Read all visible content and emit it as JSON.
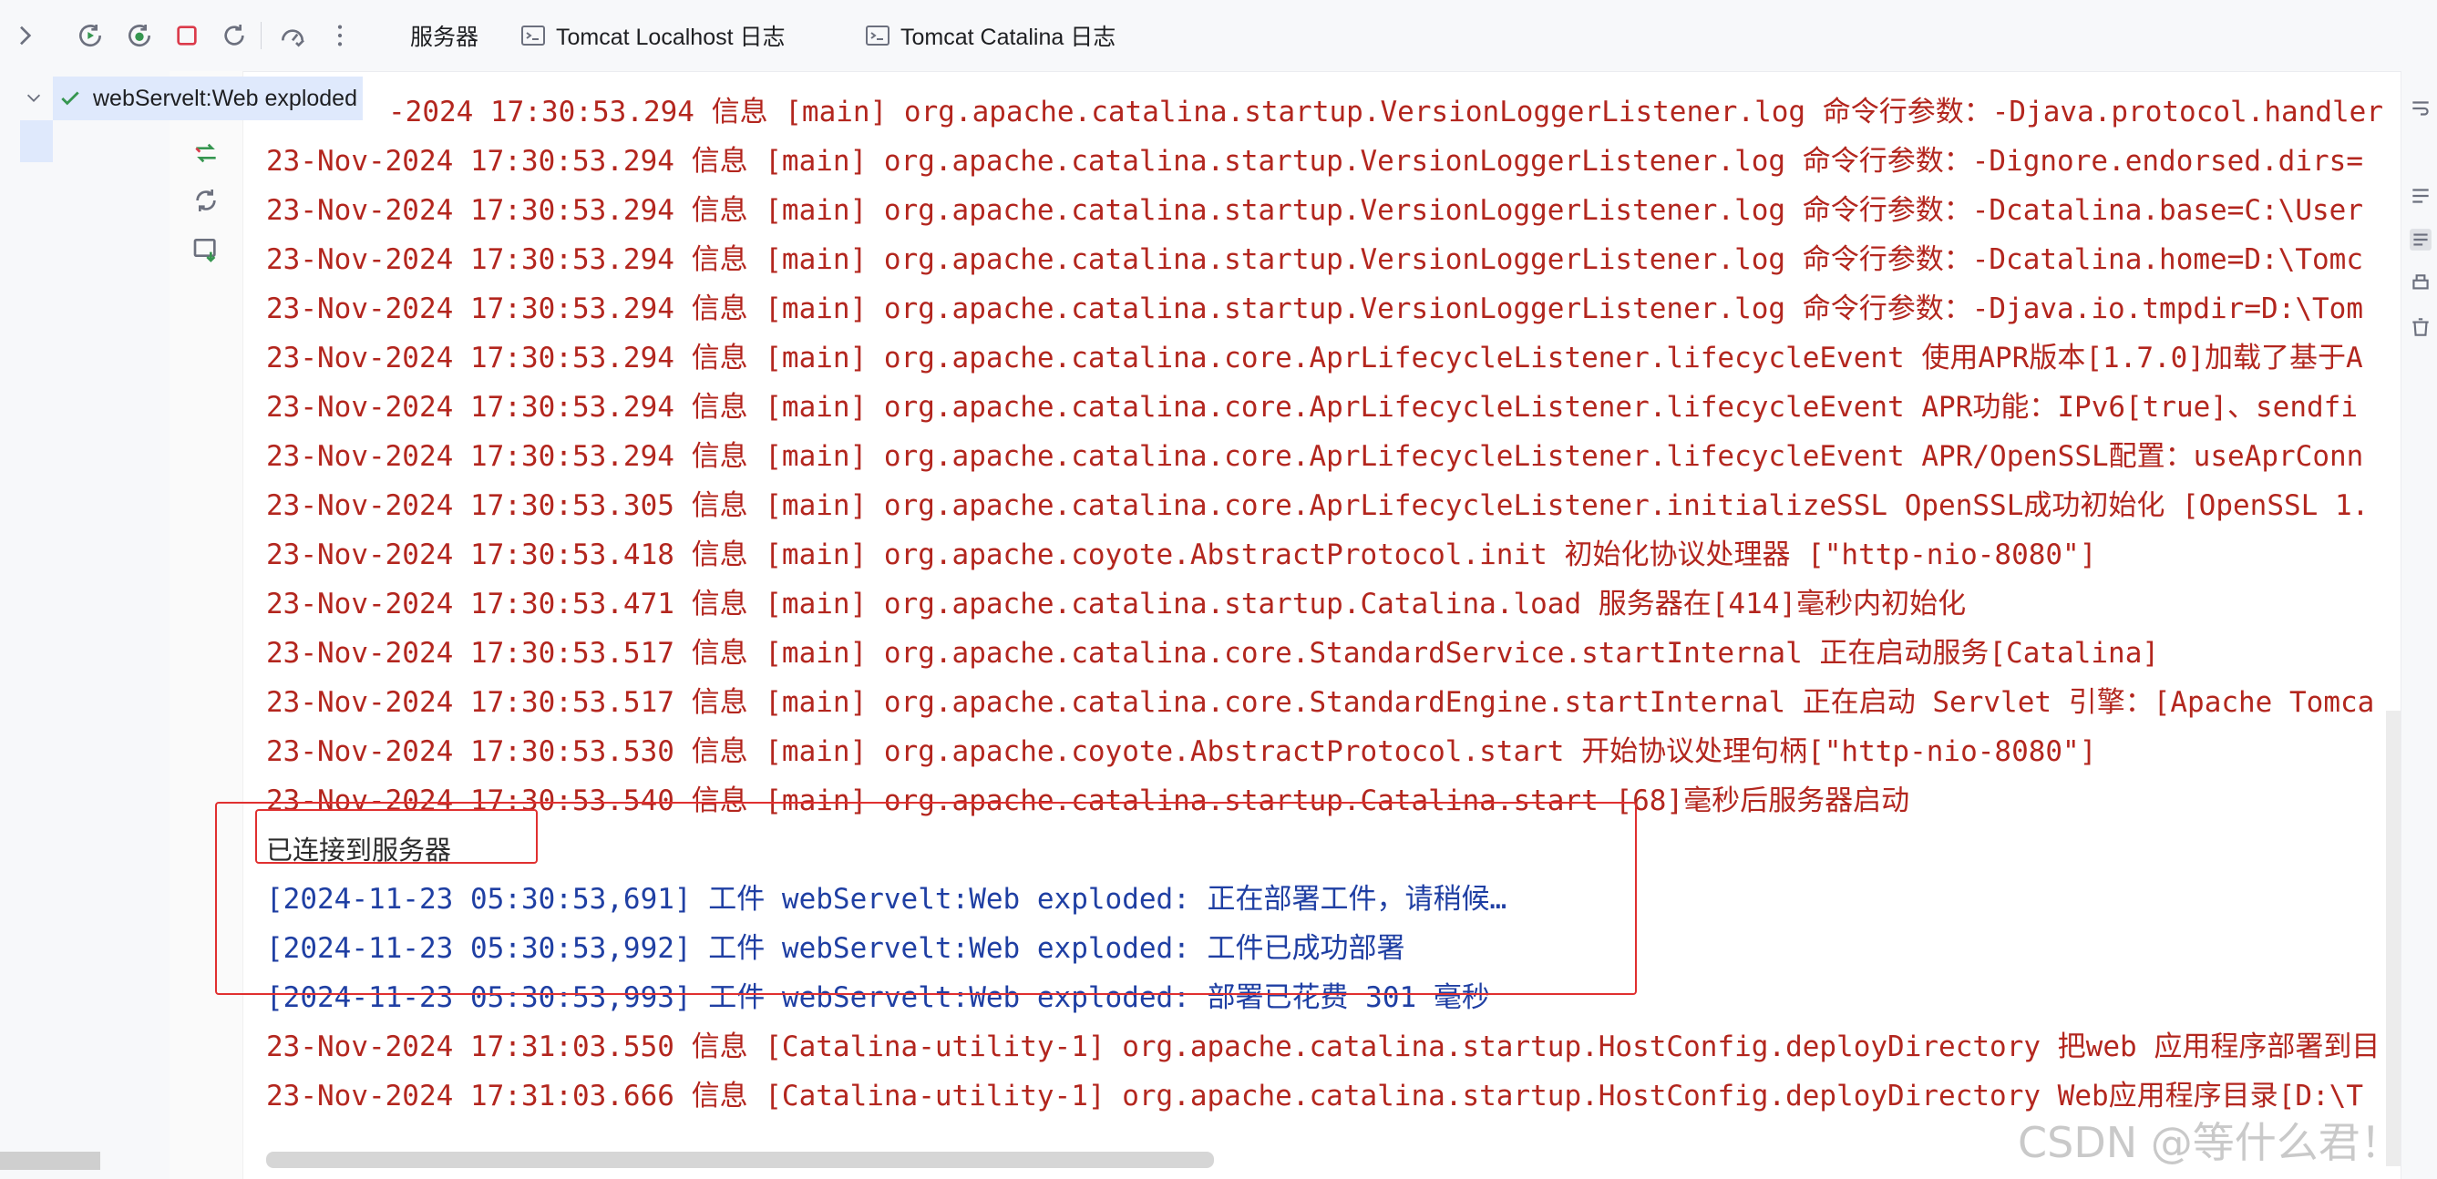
{
  "toolbar": {
    "icons": [
      "expand-chevron-icon",
      "run-icon",
      "debug-icon",
      "stop-icon",
      "rerun-icon",
      "dashboard-icon",
      "more-icon"
    ],
    "tabs": [
      {
        "label": "服务器",
        "icon": ""
      },
      {
        "label": "Tomcat Localhost 日志",
        "icon": "log-icon"
      },
      {
        "label": "Tomcat Catalina 日志",
        "icon": "log-icon"
      }
    ]
  },
  "tree": {
    "item_label": "webServelt:Web exploded",
    "status_icon": "check-icon"
  },
  "side_actions": [
    "deploy-icon",
    "refresh-icon",
    "update-icon"
  ],
  "console": {
    "lines": [
      "-2024 17:30:53.294 信息 [main] org.apache.catalina.startup.VersionLoggerListener.log 命令行参数：-Djava.protocol.handler",
      "23-Nov-2024 17:30:53.294 信息 [main] org.apache.catalina.startup.VersionLoggerListener.log 命令行参数：-Dignore.endorsed.dirs=",
      "23-Nov-2024 17:30:53.294 信息 [main] org.apache.catalina.startup.VersionLoggerListener.log 命令行参数：-Dcatalina.base=C:\\User",
      "23-Nov-2024 17:30:53.294 信息 [main] org.apache.catalina.startup.VersionLoggerListener.log 命令行参数：-Dcatalina.home=D:\\Tomc",
      "23-Nov-2024 17:30:53.294 信息 [main] org.apache.catalina.startup.VersionLoggerListener.log 命令行参数：-Djava.io.tmpdir=D:\\Tom",
      "23-Nov-2024 17:30:53.294 信息 [main] org.apache.catalina.core.AprLifecycleListener.lifecycleEvent 使用APR版本[1.7.0]加载了基于A",
      "23-Nov-2024 17:30:53.294 信息 [main] org.apache.catalina.core.AprLifecycleListener.lifecycleEvent APR功能：IPv6[true]、sendfi",
      "23-Nov-2024 17:30:53.294 信息 [main] org.apache.catalina.core.AprLifecycleListener.lifecycleEvent APR/OpenSSL配置：useAprConn",
      "23-Nov-2024 17:30:53.305 信息 [main] org.apache.catalina.core.AprLifecycleListener.initializeSSL OpenSSL成功初始化 [OpenSSL 1.",
      "23-Nov-2024 17:30:53.418 信息 [main] org.apache.coyote.AbstractProtocol.init 初始化协议处理器 [\"http-nio-8080\"]",
      "23-Nov-2024 17:30:53.471 信息 [main] org.apache.catalina.startup.Catalina.load 服务器在[414]毫秒内初始化",
      "23-Nov-2024 17:30:53.517 信息 [main] org.apache.catalina.core.StandardService.startInternal 正在启动服务[Catalina]",
      "23-Nov-2024 17:30:53.517 信息 [main] org.apache.catalina.core.StandardEngine.startInternal 正在启动 Servlet 引擎：[Apache Tomca",
      "23-Nov-2024 17:30:53.530 信息 [main] org.apache.coyote.AbstractProtocol.start 开始协议处理句柄[\"http-nio-8080\"]",
      "23-Nov-2024 17:30:53.540 信息 [main] org.apache.catalina.startup.Catalina.start [68]毫秒后服务器启动"
    ],
    "connected": "已连接到服务器",
    "deploy_lines": [
      "[2024-11-23 05:30:53,691] 工件 webServelt:Web exploded: 正在部署工件，请稍候…",
      "[2024-11-23 05:30:53,992] 工件 webServelt:Web exploded: 工件已成功部署",
      "[2024-11-23 05:30:53,993] 工件 webServelt:Web exploded: 部署已花费 301 毫秒"
    ],
    "tail_lines": [
      "23-Nov-2024 17:31:03.550 信息 [Catalina-utility-1] org.apache.catalina.startup.HostConfig.deployDirectory 把web 应用程序部署到目",
      "23-Nov-2024 17:31:03.666 信息 [Catalina-utility-1] org.apache.catalina.startup.HostConfig.deployDirectory Web应用程序目录[D:\\T"
    ]
  },
  "watermark": "CSDN @等什么君！",
  "colors": {
    "log_red": "#b3261e",
    "deploy_blue": "#1f3fa3",
    "highlight_box": "#e03030",
    "selection": "#dfe9fc",
    "accent": "#3574f0"
  }
}
